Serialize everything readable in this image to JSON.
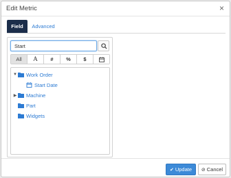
{
  "dialog": {
    "title": "Edit Metric",
    "close_glyph": "×"
  },
  "tabs": [
    {
      "label": "Field",
      "active": true
    },
    {
      "label": "Advanced",
      "active": false
    }
  ],
  "search": {
    "value": "Start",
    "button_icon": "search-icon"
  },
  "filters": [
    {
      "label": "All",
      "active": true
    },
    {
      "label": "A",
      "icon": "text-type-icon"
    },
    {
      "label": "#",
      "icon": "number-type-icon"
    },
    {
      "label": "%",
      "icon": "percent-type-icon"
    },
    {
      "label": "$",
      "icon": "currency-type-icon"
    },
    {
      "label": "",
      "icon": "calendar-icon"
    }
  ],
  "tree": [
    {
      "label": "Work Order",
      "expanded": true,
      "icon": "folder-icon",
      "level": 0
    },
    {
      "label": "Start Date",
      "icon": "calendar-icon",
      "level": 1
    },
    {
      "label": "Machine",
      "expanded": false,
      "icon": "folder-icon",
      "level": 0
    },
    {
      "label": "Part",
      "icon": "folder-icon",
      "level": 0
    },
    {
      "label": "Widgets",
      "icon": "folder-icon",
      "level": 0
    }
  ],
  "footer": {
    "update_label": "Update",
    "cancel_label": "Cancel"
  },
  "colors": {
    "tab_active_bg": "#1b2d4a",
    "link_blue": "#2d7bd3",
    "primary_button": "#3c8ad8"
  }
}
